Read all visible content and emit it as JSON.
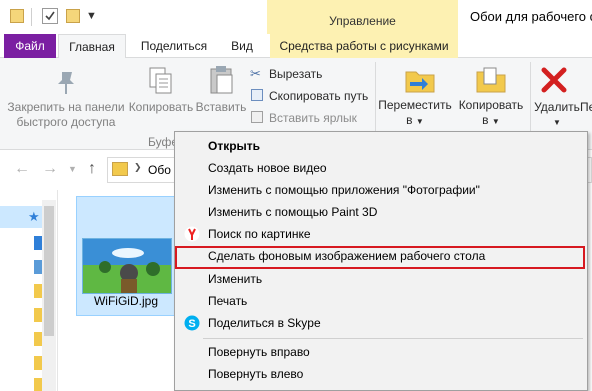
{
  "window": {
    "title": "Обои для рабочего ст",
    "context_group": "Управление"
  },
  "tabs": {
    "file": "Файл",
    "home": "Главная",
    "share": "Поделиться",
    "view": "Вид",
    "picture_tools": "Средства работы с рисунками"
  },
  "ribbon": {
    "pin_label_line1": "Закрепить на панели",
    "pin_label_line2": "быстрого доступа",
    "copy_label": "Копировать",
    "paste_label": "Вставить",
    "cut_label": "Вырезать",
    "copy_path_label": "Скопировать путь",
    "paste_shortcut_label": "Вставить ярлык",
    "clipboard_group": "Буфе",
    "move_label_line1": "Переместить",
    "move_label_line2": "в",
    "copyto_label_line1": "Копировать",
    "copyto_label_line2": "в",
    "delete_label": "Удалить",
    "rename_label": "Пе"
  },
  "address": {
    "path_fragment": "Обо"
  },
  "file": {
    "name": "WiFiGiD.jpg"
  },
  "context_menu": {
    "items": [
      "Открыть",
      "Создать новое видео",
      "Изменить с помощью приложения \"Фотографии\"",
      "Изменить с помощью Paint 3D",
      "Поиск по картинке",
      "Сделать фоновым изображением рабочего стола",
      "Изменить",
      "Печать",
      "Поделиться в Skype",
      "Повернуть вправо",
      "Повернуть влево"
    ]
  },
  "colors": {
    "file_tab": "#7b1fa2",
    "context_tab": "#fdf1b2",
    "highlight_border": "#d71920",
    "selection": "#cce8ff"
  }
}
